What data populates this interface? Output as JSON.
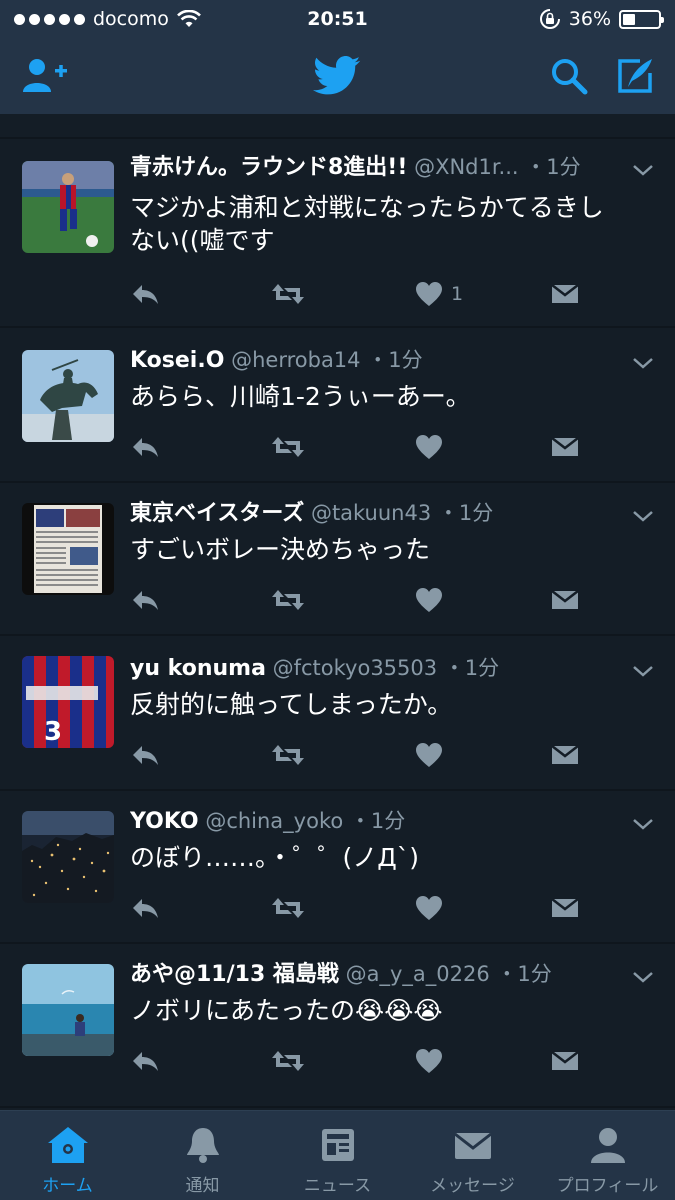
{
  "status_bar": {
    "carrier": "docomo",
    "time": "20:51",
    "battery_percent": "36%",
    "battery_level": 0.36
  },
  "nav": {
    "icons": [
      "add-user-icon",
      "twitter-bird-icon",
      "search-icon",
      "compose-tweet-icon"
    ]
  },
  "colors": {
    "background": "#141d26",
    "bar": "#243447",
    "accent": "#1da1f2",
    "muted": "#8899a6"
  },
  "tweets": [
    {
      "name": "青赤けん。ラウンド8進出!!",
      "handle": "@XNd1r...",
      "time": "・1分",
      "text_lines": [
        "マジかよ浦和と対戦になったらかてるきし",
        "ない((嘘です"
      ],
      "likes": "1"
    },
    {
      "name": "Kosei.O",
      "handle": "@herroba14",
      "time": "・1分",
      "text_lines": [
        "あらら、川崎1-2うぃーあー。"
      ],
      "likes": ""
    },
    {
      "name": "東京ベイスターズ",
      "handle": "@takuun43",
      "time": "・1分",
      "text_lines": [
        "すごいボレー決めちゃった"
      ],
      "likes": ""
    },
    {
      "name": "yu konuma",
      "handle": "@fctokyo35503",
      "time": "・1分",
      "text_lines": [
        "反射的に触ってしまったか。"
      ],
      "likes": ""
    },
    {
      "name": "YOKO",
      "handle": "@china_yoko",
      "time": "・1分",
      "text_lines": [
        "のぼり……。・゜゜(ノД`)"
      ],
      "likes": ""
    },
    {
      "name": "あや@11/13 福島戦",
      "handle": "@a_y_a_0226",
      "time": "・1分",
      "text_lines": [
        "ノボリにあたったの😭😭😭"
      ],
      "likes": ""
    }
  ],
  "tab_bar": {
    "tabs": [
      {
        "label": "ホーム",
        "icon": "home-icon",
        "active": true
      },
      {
        "label": "通知",
        "icon": "bell-icon",
        "active": false
      },
      {
        "label": "ニュース",
        "icon": "news-icon",
        "active": false
      },
      {
        "label": "メッセージ",
        "icon": "envelope-icon",
        "active": false
      },
      {
        "label": "プロフィール",
        "icon": "person-icon",
        "active": false
      }
    ]
  }
}
